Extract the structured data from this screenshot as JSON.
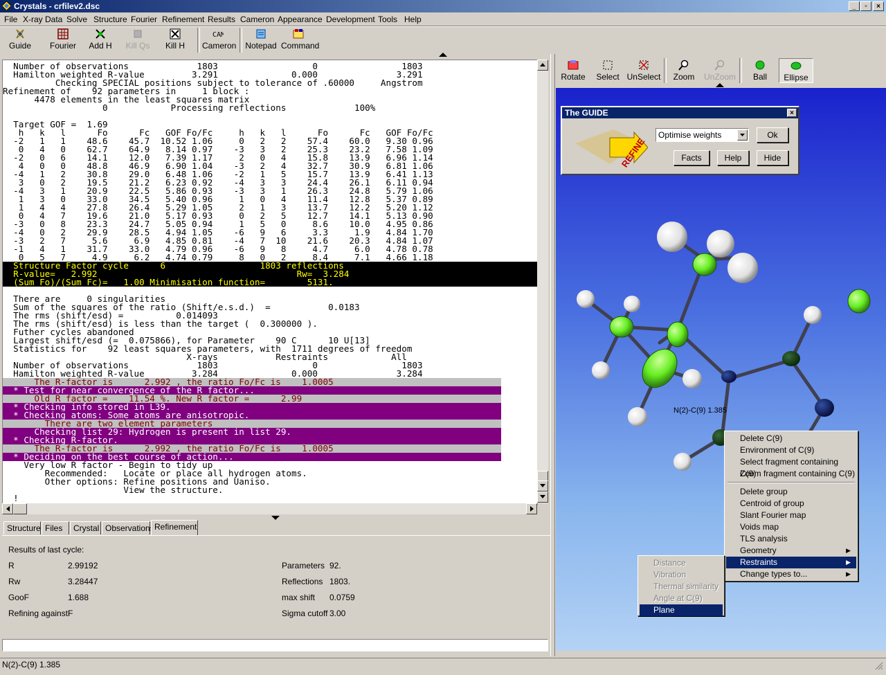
{
  "window": {
    "title": "Crystals - crfilev2.dsc",
    "minimize": "_",
    "restore": "▫",
    "close": "×"
  },
  "menu": [
    "File",
    "X-ray Data",
    "Solve",
    "Structure",
    "Fourier",
    "Refinement",
    "Results",
    "Cameron",
    "Appearance",
    "Development",
    "Tools",
    "Help"
  ],
  "toolbar": [
    "Guide",
    "Fourier",
    "Add H",
    "Kill Qs",
    "Kill H",
    "Cameron",
    "Notepad",
    "Command"
  ],
  "view_toolbar": [
    "Rotate",
    "Select",
    "UnSelect",
    "Zoom",
    "UnZoom",
    "Ball",
    "Ellipse"
  ],
  "output_lines": [
    {
      "t": "  Number of observations             1803                  0                1803",
      "s": "n"
    },
    {
      "t": "  Hamilton weighted R-value         3.291              0.000               3.291",
      "s": "n"
    },
    {
      "t": "          Checking SPECIAL positions subject to tolerance of .60000     Angstrom",
      "s": "n"
    },
    {
      "t": "Refinement of    92 parameters in     1 block :",
      "s": "n"
    },
    {
      "t": "      4478 elements in the least squares matrix",
      "s": "n"
    },
    {
      "t": "                   0            Processing reflections             100%",
      "s": "n"
    },
    {
      "t": "",
      "s": "n"
    },
    {
      "t": "  Target GOF =  1.69",
      "s": "n"
    },
    {
      "t": "   h   k   l      Fo      Fc   GOF Fo/Fc     h   k   l      Fo      Fc   GOF Fo/Fc",
      "s": "n"
    },
    {
      "t": "  -2   1   1    48.6    45.7  10.52 1.06     0   2   2    57.4    60.0   9.30 0.96",
      "s": "n"
    },
    {
      "t": "   0   4   0    62.7    64.9   8.14 0.97    -3   3   2    25.3    23.2   7.58 1.09",
      "s": "n"
    },
    {
      "t": "  -2   0   6    14.1    12.0   7.39 1.17     2   0   4    15.8    13.9   6.96 1.14",
      "s": "n"
    },
    {
      "t": "   4   0   0    48.8    46.9   6.90 1.04    -3   2   4    32.7    30.9   6.81 1.06",
      "s": "n"
    },
    {
      "t": "  -4   1   2    30.8    29.0   6.48 1.06    -2   1   5    15.7    13.9   6.41 1.13",
      "s": "n"
    },
    {
      "t": "   3   0   2    19.5    21.2   6.23 0.92    -4   3   3    24.4    26.1   6.11 0.94",
      "s": "n"
    },
    {
      "t": "  -4   3   1    20.9    22.5   5.86 0.93    -3   3   1    26.3    24.8   5.79 1.06",
      "s": "n"
    },
    {
      "t": "   1   3   0    33.0    34.5   5.40 0.96     1   0   4    11.4    12.8   5.37 0.89",
      "s": "n"
    },
    {
      "t": "   1   4   4    27.8    26.4   5.29 1.05     2   1   3    13.7    12.2   5.20 1.12",
      "s": "n"
    },
    {
      "t": "   0   4   7    19.6    21.0   5.17 0.93     0   2   5    12.7    14.1   5.13 0.90",
      "s": "n"
    },
    {
      "t": "  -3   0   8    23.3    24.7   5.05 0.94     1   5   0     8.6    10.0   4.95 0.86",
      "s": "n"
    },
    {
      "t": "  -4   0   2    29.9    28.5   4.94 1.05    -6   9   6     3.3     1.9   4.84 1.70",
      "s": "n"
    },
    {
      "t": "  -3   2   7     5.6     6.9   4.85 0.81    -4   7  10    21.6    20.3   4.84 1.07",
      "s": "n"
    },
    {
      "t": "  -1   4   1    31.7    33.0   4.79 0.96    -6   9   8     4.7     6.0   4.78 0.78",
      "s": "n"
    },
    {
      "t": "   0   5   7     4.9     6.2   4.74 0.79     8   0   2     8.4     7.1   4.66 1.18",
      "s": "n"
    },
    {
      "t": "  Structure Factor cycle      6                  1803 reflections",
      "s": "y"
    },
    {
      "t": "  R-value=   2.992                                      Rw=  3.284",
      "s": "y"
    },
    {
      "t": "  (Sum Fo)/(Sum Fc)=   1.00 Minimisation function=        5131.",
      "s": "y"
    },
    {
      "t": "",
      "s": "n"
    },
    {
      "t": "  There are     0 singularities",
      "s": "n"
    },
    {
      "t": "  Sum of the squares of the ratio (Shift/e.s.d.)  =           0.0183",
      "s": "n"
    },
    {
      "t": "  The rms (shift/esd) =          0.014093",
      "s": "n"
    },
    {
      "t": "  The rms (shift/esd) is less than the target (  0.300000 ).",
      "s": "n"
    },
    {
      "t": "  Futher cycles abandoned",
      "s": "n"
    },
    {
      "t": "  Largest shift/esd (=  0.075866), for Parameter    90 C      10 U[13]",
      "s": "n"
    },
    {
      "t": "  Statistics for    92 least squares parameters, with  1711 degrees of freedom",
      "s": "n"
    },
    {
      "t": "                                   X-rays           Restraints            All",
      "s": "n"
    },
    {
      "t": "  Number of observations             1803                  0                1803",
      "s": "n"
    },
    {
      "t": "  Hamilton weighted R-value         3.284              0.000               3.284",
      "s": "n"
    },
    {
      "t": "      The R-factor is      2.992 , the ratio Fo/Fc is    1.0005",
      "s": "pg"
    },
    {
      "t": "  * Test for near convergence of the R factor...",
      "s": "p"
    },
    {
      "t": "      Old R factor =    11.54 %. New R factor =      2.99",
      "s": "pg"
    },
    {
      "t": "  * Checking info stored in L39.",
      "s": "p"
    },
    {
      "t": "  * Checking atoms: Some atoms are anisotropic.",
      "s": "p"
    },
    {
      "t": "        There are two element parameters",
      "s": "pg"
    },
    {
      "t": "      Checking list 29: Hydrogen is present in list 29.",
      "s": "p"
    },
    {
      "t": "  * Checking R-factor.",
      "s": "p"
    },
    {
      "t": "      The R-factor is      2.992 , the ratio Fo/Fc is    1.0005",
      "s": "pg"
    },
    {
      "t": "  * Deciding on the best course of action...",
      "s": "p"
    },
    {
      "t": "    Very low R factor - Begin to tidy up",
      "s": "n"
    },
    {
      "t": "        Recommended:   Locate or place all hydrogen atoms.",
      "s": "n"
    },
    {
      "t": "        Other options: Refine positions and Uaniso.",
      "s": "n"
    },
    {
      "t": "                       View the structure.",
      "s": "n"
    },
    {
      "t": "  !",
      "s": "n"
    }
  ],
  "tabs": [
    "Structure",
    "Files",
    "Crystal",
    "Observations",
    "Refinement"
  ],
  "results": {
    "heading": "Results of last cycle:",
    "left": [
      [
        "R",
        "2.99192"
      ],
      [
        "Rw",
        "3.28447"
      ],
      [
        "GooF",
        "1.688"
      ],
      [
        "Refining against",
        "F"
      ]
    ],
    "right": [
      [
        "Parameters",
        "92."
      ],
      [
        "Reflections",
        "1803."
      ],
      [
        "max shift",
        "0.0759"
      ],
      [
        "Sigma cutoff",
        "3.00"
      ]
    ]
  },
  "guide": {
    "title": "The GUIDE",
    "logo_text": "REFINE",
    "select_value": "Optimise weights",
    "ok": "Ok",
    "facts": "Facts",
    "help": "Help",
    "hide": "Hide"
  },
  "bond_label": "N(2)-C(9) 1.385",
  "context_menu": [
    "Delete C(9)",
    "Environment of C(9)",
    "Select fragment containing C(9)",
    "Zoom fragment containing C(9)",
    "Delete group",
    "Centroid of group",
    "Slant Fourier map",
    "Voids map",
    "TLS analysis",
    "Geometry",
    "Restraints",
    "Change types to..."
  ],
  "submenu": [
    "Distance",
    "Vibration",
    "Thermal similarity",
    "Angle at C(9)",
    "Plane"
  ],
  "status": "N(2)-C(9) 1.385",
  "colors": {
    "title_bar": "#0a246a",
    "highlight": "#0a246a",
    "purple": "#800080",
    "yellow": "#ffff00",
    "atom_green": "#66ff33"
  }
}
